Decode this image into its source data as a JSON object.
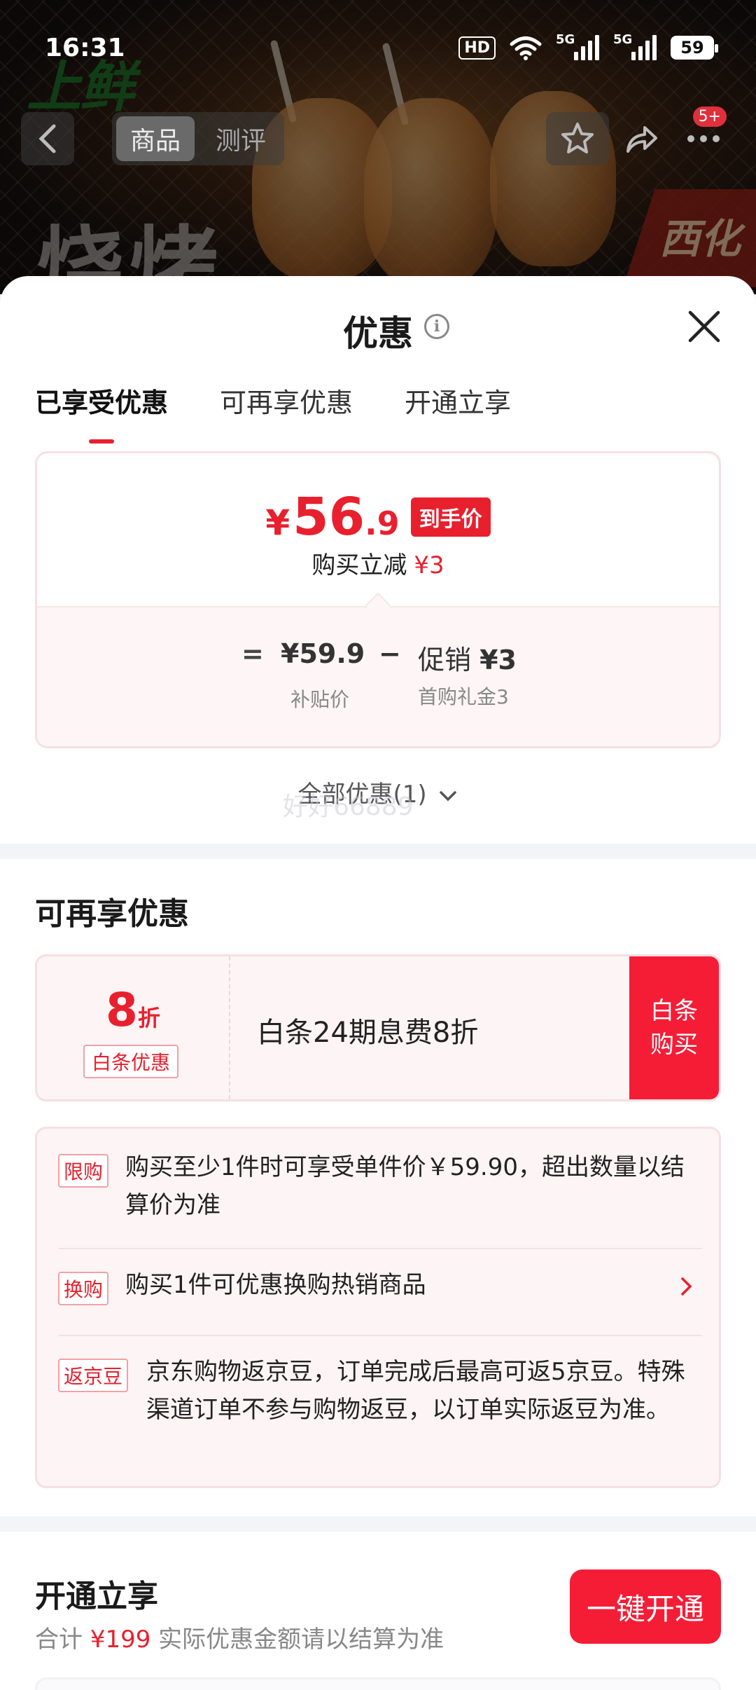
{
  "status_bar": {
    "time": "16:31",
    "hd_label": "HD",
    "sim1_label": "5G",
    "sim2_label": "5G",
    "battery": "59"
  },
  "hero": {
    "logo_text": "上鲜",
    "big_text": "烧烤",
    "brand_text": "西化"
  },
  "nav": {
    "tabs": [
      {
        "label": "商品",
        "active": true
      },
      {
        "label": "测评",
        "active": false
      }
    ],
    "badge": "5+"
  },
  "sheet": {
    "title": "优惠",
    "tabs": [
      {
        "label": "已享受优惠",
        "active": true
      },
      {
        "label": "可再享优惠",
        "active": false
      },
      {
        "label": "开通立享",
        "active": false
      }
    ]
  },
  "price_card": {
    "yen": "¥",
    "price_int": "56",
    "price_dec": ".9",
    "price_tag": "到手价",
    "sub_label": "购买立减",
    "sub_value": "¥3",
    "breakdown": {
      "equals": "=",
      "subsidy_value": "¥59.9",
      "subsidy_label": "补贴价",
      "minus": "−",
      "promo_label_prefix": "促销",
      "promo_value": "¥3",
      "promo_desc": "首购礼金3"
    }
  },
  "all_promos": "全部优惠(1)",
  "watermark": "好好66889",
  "more_section": {
    "title": "可再享优惠",
    "coupon": {
      "discount_num": "8",
      "discount_unit": "折",
      "tag": "白条优惠",
      "description": "白条24期息费8折",
      "button_line1": "白条",
      "button_line2": "购买"
    },
    "rules": [
      {
        "tag": "限购",
        "text": "购买至少1件时可享受单件价￥59.90，超出数量以结算价为准"
      },
      {
        "tag": "换购",
        "text": "购买1件可优惠换购热销商品"
      },
      {
        "tag": "返京豆",
        "text": "京东购物返京豆，订单完成后最高可返5京豆。特殊渠道订单不参与购物返豆，以订单实际返豆为准。"
      }
    ]
  },
  "join_section": {
    "title": "开通立享",
    "button": "一键开通",
    "sub_prefix": "合计",
    "sub_amount": "¥199",
    "sub_suffix": "实际优惠金额请以结算为准"
  },
  "colors": {
    "accent": "#e8202e",
    "button_red": "#f51d36",
    "card_border": "#f6dfe2",
    "card_bg": "#fdf4f5"
  }
}
